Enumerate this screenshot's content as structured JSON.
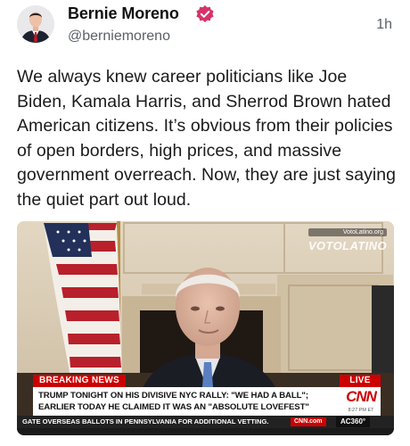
{
  "author": {
    "name": "Bernie Moreno",
    "handle": "@berniemoreno",
    "verified_icon": "verified-badge-icon",
    "verified_color": "#d6336c"
  },
  "post": {
    "timestamp": "1h",
    "text": "We always knew career politicians like Joe Biden, Kamala Harris, and Sherrod Brown hated American citizens. It’s obvious from their policies of open borders, high prices, and massive government overreach. Now, they are just saying the quiet part out loud."
  },
  "video": {
    "watermark_url": "VotoLatino.org",
    "watermark_logo": "VOTOLATINO",
    "breaking_label": "BREAKING NEWS",
    "live_label": "LIVE",
    "headline_line1": "TRUMP TONIGHT ON HIS DIVISIVE NYC RALLY: \"WE HAD A BALL\";",
    "headline_line2": "EARLIER TODAY HE CLAIMED IT WAS AN \"ABSOLUTE LOVEFEST\"",
    "network_logo": "CNN",
    "network_time": "8:27 PM ET",
    "ticker_text": "GATE OVERSEAS BALLOTS IN PENNSYLVANIA FOR ADDITIONAL VETTING.",
    "ticker_site": "CNN.com",
    "ticker_show": "AC360°"
  },
  "colors": {
    "cnn_red": "#cc0000",
    "text": "#1b1b1b",
    "secondary": "#5b6066"
  }
}
